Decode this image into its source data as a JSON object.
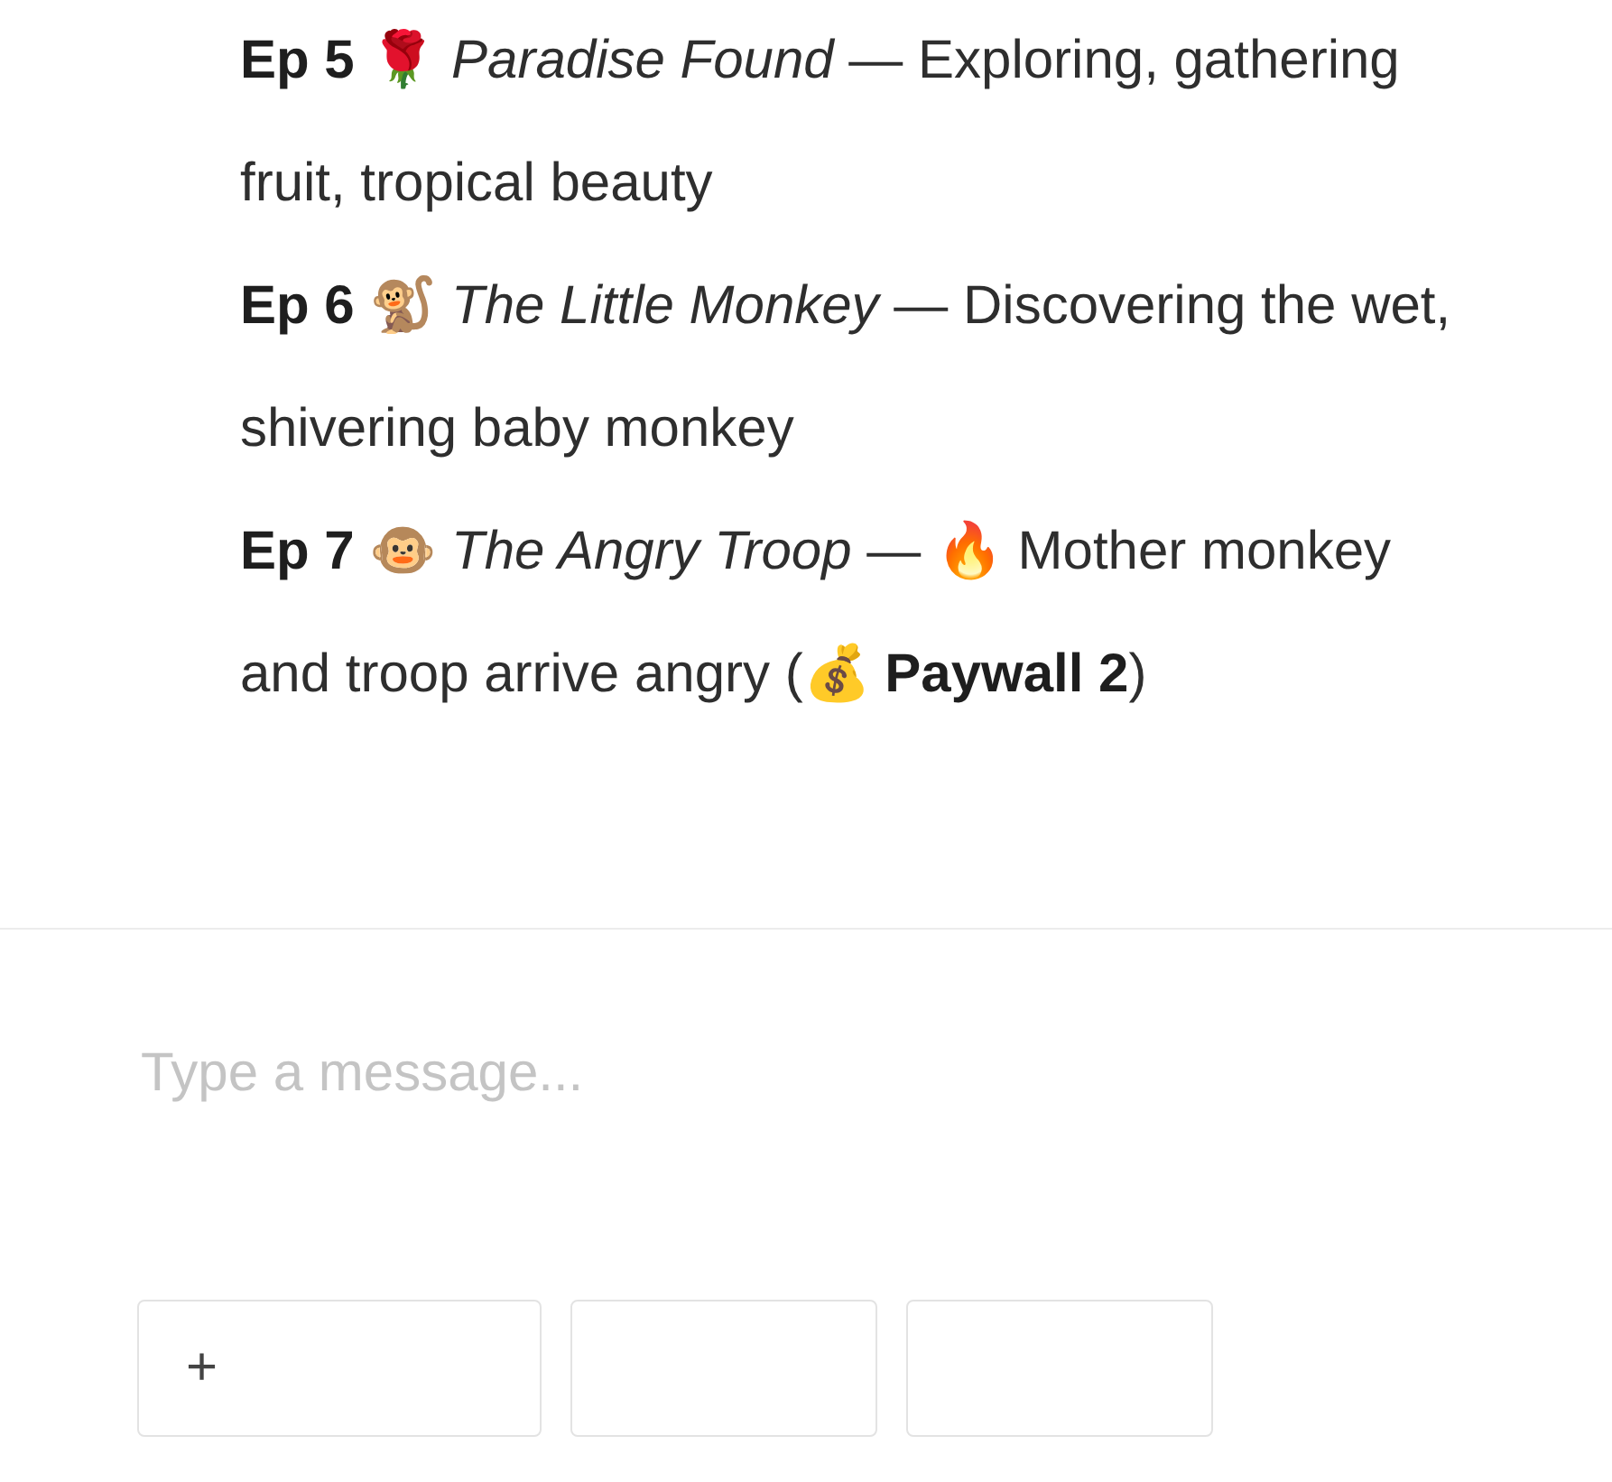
{
  "messages": [
    {
      "text": "**Ep 5** 🌹 *Paradise Found* — Exploring, gathering fruit, tropical beauty"
    },
    {
      "text": "**Ep 6** 🐒 *The Little Monkey* — Discovering the wet, shivering baby monkey"
    },
    {
      "text": "**Ep 7** 🐵 *The Angry Troop* — 🔥 Mother monkey and troop arrive angry (💰 **Paywall 2**)"
    }
  ],
  "composer": {
    "placeholder": "Type a message..."
  },
  "buttons": [
    {
      "kind": "icon",
      "label": "+"
    },
    {
      "kind": "blank"
    },
    {
      "kind": "blank"
    }
  ]
}
